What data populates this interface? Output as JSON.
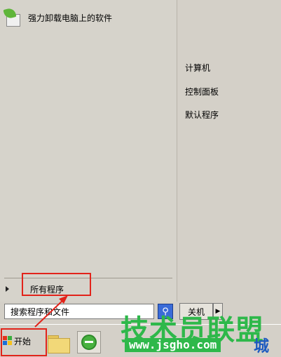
{
  "start_menu": {
    "pinned": [
      {
        "label": "强力卸载电脑上的软件",
        "icon": "uninstaller-icon"
      }
    ],
    "all_programs_label": "所有程序",
    "right_items": [
      {
        "label": "计算机"
      },
      {
        "label": "控制面板"
      },
      {
        "label": "默认程序"
      }
    ],
    "search": {
      "value": "搜索程序和文件",
      "icon": "search-icon"
    },
    "shutdown_label": "关机"
  },
  "taskbar": {
    "start_label": "开始",
    "items": [
      {
        "icon": "folder-icon"
      },
      {
        "icon": "ie-icon"
      }
    ]
  },
  "watermark": {
    "text": "技术员联盟",
    "url": "www.jsgho.com",
    "extra": "城"
  },
  "colors": {
    "highlight": "#e2231a",
    "watermark_green": "#2eb84a",
    "panel_bg": "#d4d0c8"
  }
}
